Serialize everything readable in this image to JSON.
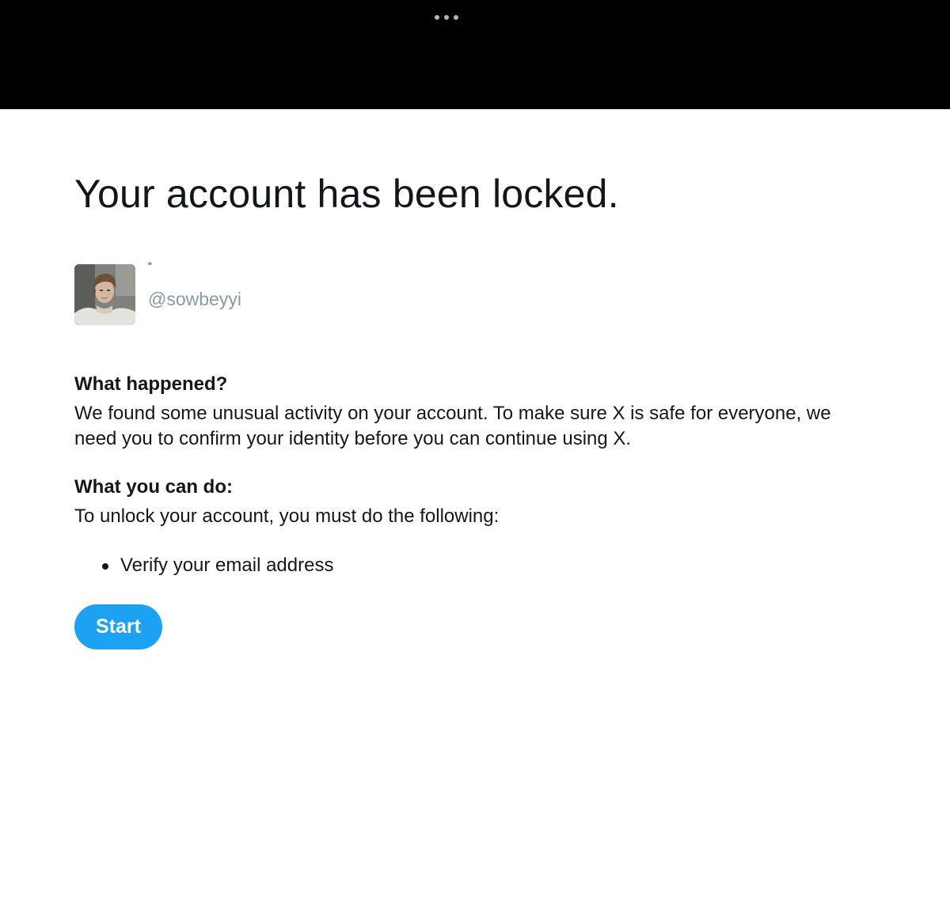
{
  "header": {
    "more_icon": "more-horizontal-icon"
  },
  "page": {
    "title": "Your account has been locked."
  },
  "profile": {
    "display_name": "˭",
    "handle": "@sowbeyyi"
  },
  "what_happened": {
    "heading": "What happened?",
    "text": "We found some unusual activity on your account. To make sure X is safe for everyone, we need you to confirm your identity before you can continue using X."
  },
  "what_you_can_do": {
    "heading": "What you can do:",
    "text": "To unlock your account, you must do the following:",
    "steps": [
      "Verify your email address"
    ]
  },
  "actions": {
    "start_label": "Start"
  },
  "colors": {
    "accent": "#1da1f2",
    "handle": "#8899a6",
    "top_bar": "#000000"
  }
}
